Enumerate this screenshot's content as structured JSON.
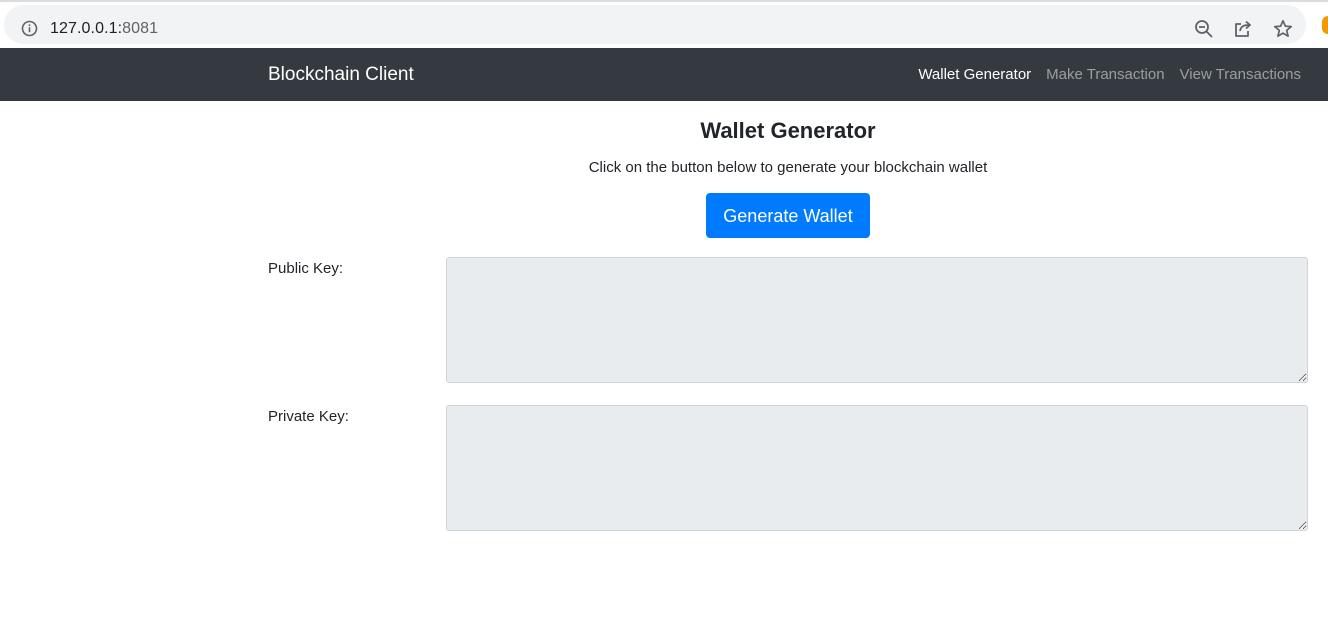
{
  "browser": {
    "url_host": "127.0.0.1:",
    "url_port": "8081",
    "icons": [
      "info-icon",
      "zoom-out-icon",
      "share-icon",
      "bookmark-star-icon"
    ]
  },
  "navbar": {
    "brand": "Blockchain Client",
    "links": [
      {
        "label": "Wallet Generator",
        "active": true
      },
      {
        "label": "Make Transaction",
        "active": false
      },
      {
        "label": "View Transactions",
        "active": false
      }
    ],
    "background": "#343a40"
  },
  "main": {
    "title": "Wallet Generator",
    "subtitle": "Click on the button below to generate your blockchain wallet",
    "generate_button": "Generate Wallet",
    "accent_color": "#007bff",
    "fields": [
      {
        "label": "Public Key:",
        "value": ""
      },
      {
        "label": "Private Key:",
        "value": ""
      }
    ]
  }
}
